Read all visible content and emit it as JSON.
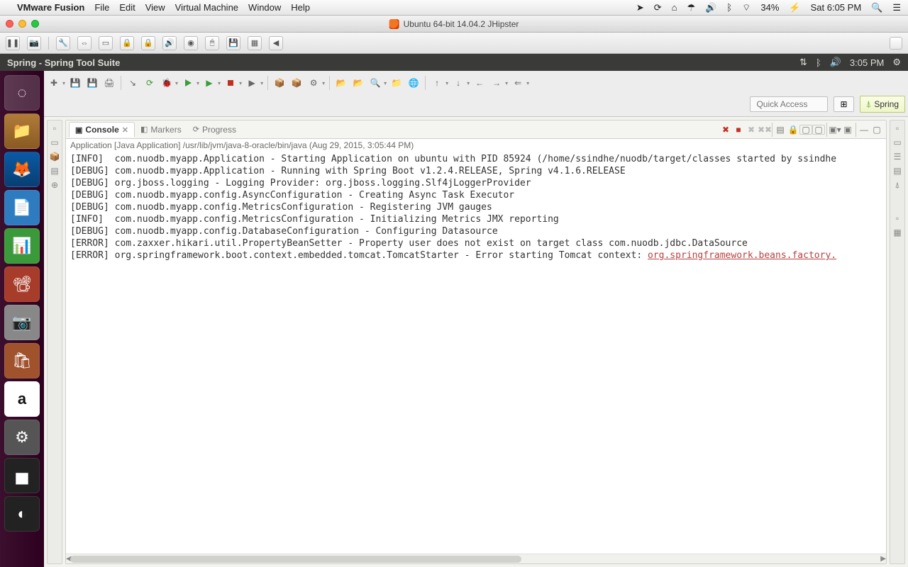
{
  "mac_menubar": {
    "app": "VMware Fusion",
    "items": [
      "File",
      "Edit",
      "View",
      "Virtual Machine",
      "Window",
      "Help"
    ],
    "battery": "34%",
    "clock": "Sat 6:05 PM"
  },
  "vmware": {
    "title": "Ubuntu 64-bit 14.04.2 JHipster"
  },
  "ubuntu_bar": {
    "title": "Spring - Spring Tool Suite",
    "clock": "3:05 PM"
  },
  "eclipse": {
    "quick_access_placeholder": "Quick Access",
    "perspective": "Spring",
    "tabs": {
      "console": "Console",
      "markers": "Markers",
      "progress": "Progress"
    },
    "console_header": "Application [Java Application] /usr/lib/jvm/java-8-oracle/bin/java (Aug 29, 2015, 3:05:44 PM)",
    "log_lines": [
      "[INFO]  com.nuodb.myapp.Application - Starting Application on ubuntu with PID 85924 (/home/ssindhe/nuodb/target/classes started by ssindhe",
      "[DEBUG] com.nuodb.myapp.Application - Running with Spring Boot v1.2.4.RELEASE, Spring v4.1.6.RELEASE",
      "[DEBUG] org.jboss.logging - Logging Provider: org.jboss.logging.Slf4jLoggerProvider",
      "[DEBUG] com.nuodb.myapp.config.AsyncConfiguration - Creating Async Task Executor",
      "[DEBUG] com.nuodb.myapp.config.MetricsConfiguration - Registering JVM gauges",
      "[INFO]  com.nuodb.myapp.config.MetricsConfiguration - Initializing Metrics JMX reporting",
      "[DEBUG] com.nuodb.myapp.config.DatabaseConfiguration - Configuring Datasource",
      "[ERROR] com.zaxxer.hikari.util.PropertyBeanSetter - Property user does not exist on target class com.nuodb.jdbc.DataSource",
      "[ERROR] org.springframework.boot.context.embedded.tomcat.TomcatStarter - Error starting Tomcat context: "
    ],
    "error_link": "org.springframework.beans.factory."
  }
}
